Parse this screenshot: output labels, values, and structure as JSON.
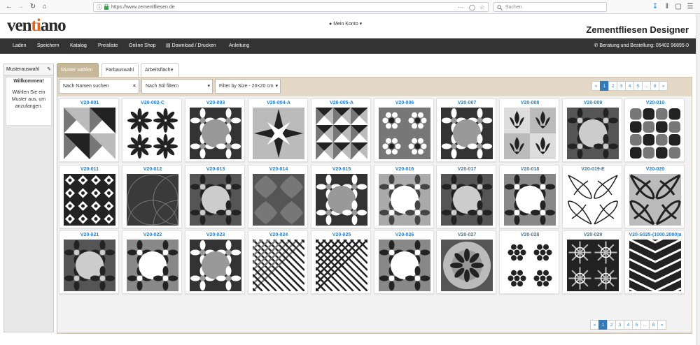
{
  "browser": {
    "url": "https://www.zementfliesen.de",
    "search_placeholder": "Suchen",
    "menu_dots": "···"
  },
  "header": {
    "logo_pre": "ven",
    "logo_mid": "ti",
    "logo_post": "ano",
    "account": "Mein Konto",
    "brand_title": "Zementfliesen Designer"
  },
  "nav": {
    "items": [
      "Laden",
      "Speichern",
      "Katalog",
      "Preisliste",
      "Online Shop",
      "Download / Drucken",
      "Anleitung"
    ],
    "contact": "Beratung und Bestellung: 05402 96895-0"
  },
  "sidebar": {
    "title": "Musterauswahl",
    "welcome": "Willkommen!",
    "hint": "Wählen Sie ein Muster aus, um anzufangen."
  },
  "tabs": [
    "Muster wählen",
    "Farbauswahl",
    "Arbeitsfläche"
  ],
  "filters": {
    "name_placeholder": "Nach Namen suchen",
    "style_value": "Nach Stil filtern",
    "size_value": "Filter by Size - 20×20 cm"
  },
  "pagination": [
    "«",
    "1",
    "2",
    "3",
    "4",
    "5",
    "...",
    "8",
    "»"
  ],
  "tiles": [
    {
      "code": "V20-001",
      "pattern": "pinwheel"
    },
    {
      "code": "V20-002-C",
      "pattern": "star-black"
    },
    {
      "code": "V20-003",
      "pattern": "ornate-grey"
    },
    {
      "code": "V20-004-A",
      "pattern": "compass-star"
    },
    {
      "code": "V20-005-A",
      "pattern": "cubes"
    },
    {
      "code": "V20-006",
      "pattern": "floral-circles"
    },
    {
      "code": "V20-007",
      "pattern": "baroque"
    },
    {
      "code": "V20-008",
      "pattern": "fleur-de-lis"
    },
    {
      "code": "V20-009",
      "pattern": "damask"
    },
    {
      "code": "V20-010",
      "pattern": "rounded-squares"
    },
    {
      "code": "V20-011",
      "pattern": "diamond-lattice"
    },
    {
      "code": "V20-012",
      "pattern": "arcs-dark"
    },
    {
      "code": "V20-013",
      "pattern": "lobed-medallion"
    },
    {
      "code": "V20-014",
      "pattern": "quatrefoil-dark"
    },
    {
      "code": "V20-015",
      "pattern": "geometric-mix"
    },
    {
      "code": "V20-016",
      "pattern": "floral-white"
    },
    {
      "code": "V20-017",
      "pattern": "leaf-star"
    },
    {
      "code": "V20-018",
      "pattern": "lace"
    },
    {
      "code": "V20-019-E",
      "pattern": "line-art"
    },
    {
      "code": "V20-020",
      "pattern": "swirls"
    },
    {
      "code": "V20-021",
      "pattern": "victorian"
    },
    {
      "code": "V20-022",
      "pattern": "mosaic"
    },
    {
      "code": "V20-023",
      "pattern": "medallion-grey"
    },
    {
      "code": "V20-024",
      "pattern": "cross-lines"
    },
    {
      "code": "V20-025",
      "pattern": "chevron-diamond"
    },
    {
      "code": "V20-026",
      "pattern": "ornate-dark"
    },
    {
      "code": "V20-027",
      "pattern": "circle-medallion"
    },
    {
      "code": "V20-028",
      "pattern": "flower-grid"
    },
    {
      "code": "V20-029",
      "pattern": "moroccan"
    },
    {
      "code": "V20-S025-(1000.2000)a",
      "pattern": "chevron"
    }
  ],
  "colors": {
    "nav_bg": "#333333",
    "panel_bg": "#e3d9c6",
    "active_tab": "#c8b89a",
    "link_blue": "#2a7fc1",
    "accent_orange": "#e0641c"
  }
}
